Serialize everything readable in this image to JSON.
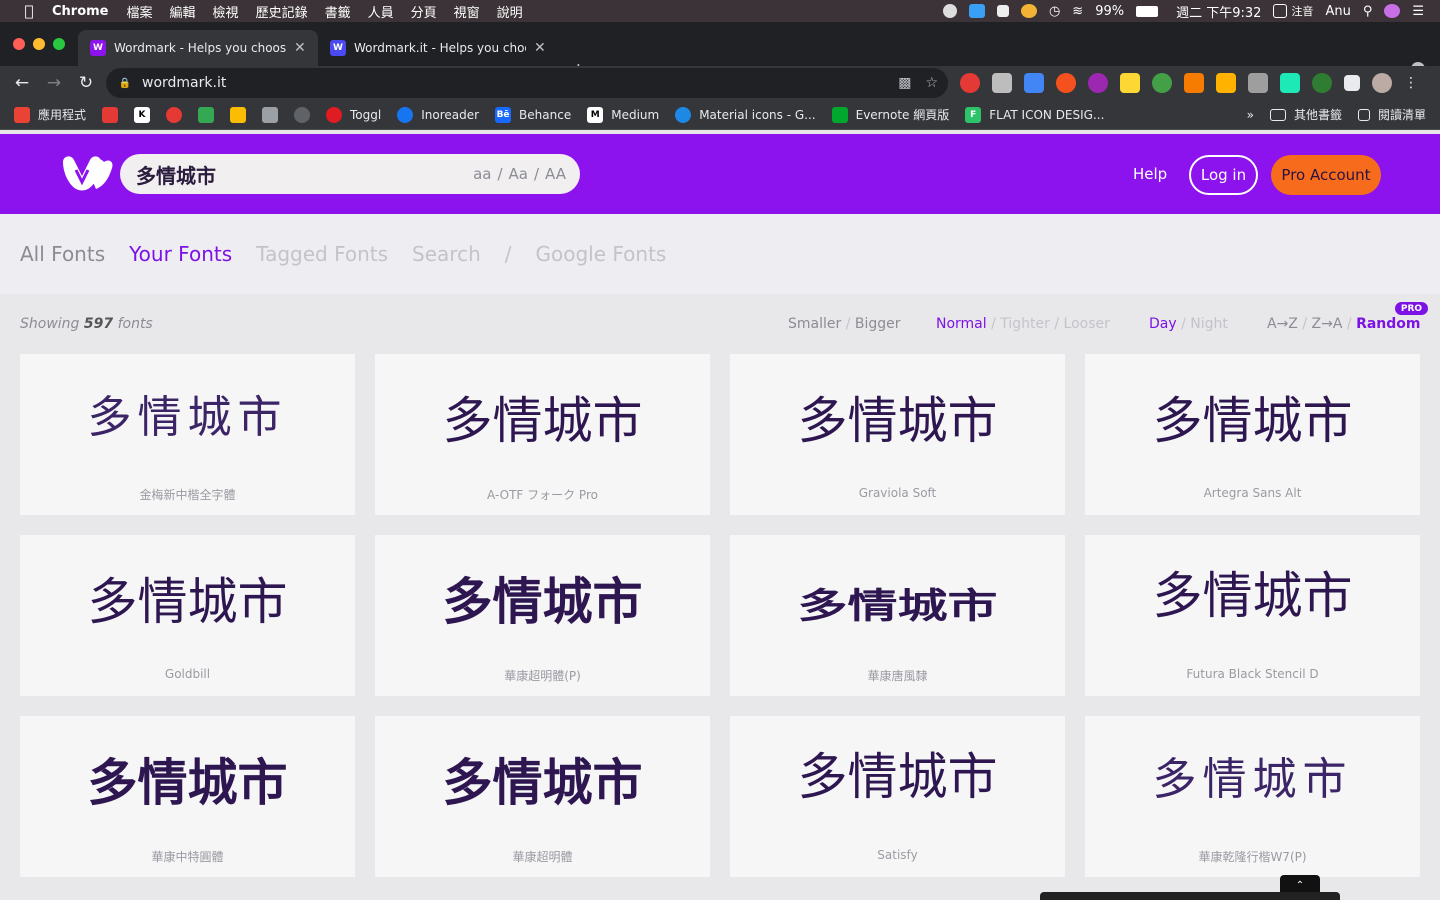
{
  "menubar": {
    "app": "Chrome",
    "items": [
      "檔案",
      "編輯",
      "檢視",
      "歷史記錄",
      "書籤",
      "人員",
      "分頁",
      "視窗",
      "說明"
    ],
    "battery": "99%",
    "clock": "週二 下午9:32",
    "input_method": "注音",
    "user": "Anu"
  },
  "tabs": [
    {
      "title": "Wordmark - Helps you choose",
      "active": true
    },
    {
      "title": "Wordmark.it - Helps you choos",
      "active": false
    }
  ],
  "omnibox": {
    "url": "wordmark.it"
  },
  "bookmarks": [
    {
      "label": "應用程式",
      "icon": "apps-grid-icon",
      "color": "#ea4335"
    },
    {
      "label": "",
      "icon": "red-app-icon",
      "color": "#e53935"
    },
    {
      "label": "",
      "icon": "k-icon",
      "color": "#ffffff"
    },
    {
      "label": "",
      "icon": "red-circle-icon",
      "color": "#e53935"
    },
    {
      "label": "",
      "icon": "drive-icon",
      "color": "#34a853"
    },
    {
      "label": "",
      "icon": "keep-icon",
      "color": "#fbbc04"
    },
    {
      "label": "",
      "icon": "book-icon",
      "color": "#9aa0a6"
    },
    {
      "label": "",
      "icon": "apple-icon",
      "color": "#5f6368"
    },
    {
      "label": "Toggl",
      "icon": "toggl-icon",
      "color": "#e01b22"
    },
    {
      "label": "Inoreader",
      "icon": "inoreader-icon",
      "color": "#1875f0"
    },
    {
      "label": "Behance",
      "icon": "behance-icon",
      "color": "#1769ff"
    },
    {
      "label": "Medium",
      "icon": "medium-icon",
      "color": "#ffffff"
    },
    {
      "label": "Material icons - G...",
      "icon": "material-icon",
      "color": "#1e88e5"
    },
    {
      "label": "Evernote 網頁版",
      "icon": "evernote-icon",
      "color": "#00a82d"
    },
    {
      "label": "FLAT ICON DESIG...",
      "icon": "flaticon-icon",
      "color": "#2cc36b"
    }
  ],
  "bookmarks_right": {
    "more": "»",
    "other": "其他書籤",
    "reading": "閱讀清單"
  },
  "header": {
    "search_value": "多情城市",
    "case_options": [
      "aa",
      "Aa",
      "AA"
    ],
    "help": "Help",
    "login": "Log in",
    "pro": "Pro Account"
  },
  "nav": {
    "tabs": [
      "All Fonts",
      "Your Fonts",
      "Tagged Fonts",
      "Search",
      "/",
      "Google Fonts"
    ],
    "active": "Your Fonts"
  },
  "controls": {
    "showing_prefix": "Showing",
    "count": "597",
    "showing_suffix": "fonts",
    "size": [
      "Smaller",
      "Bigger"
    ],
    "spacing": [
      "Normal",
      "Tighter",
      "Looser"
    ],
    "theme": [
      "Day",
      "Night"
    ],
    "sort": [
      "A→Z",
      "Z→A",
      "Random"
    ],
    "pro_badge": "PRO"
  },
  "sample_text": "多情城市",
  "fonts": [
    {
      "name": "金梅新中楷全字體",
      "style": "thin serif"
    },
    {
      "name": "A-OTF フォーク Pro",
      "style": ""
    },
    {
      "name": "Graviola Soft",
      "style": ""
    },
    {
      "name": "Artegra Sans Alt",
      "style": ""
    },
    {
      "name": "Goldbill",
      "style": "serif"
    },
    {
      "name": "華康超明體(P)",
      "style": "bold serif"
    },
    {
      "name": "華康唐風隸",
      "style": "bold squish"
    },
    {
      "name": "Futura Black Stencil D",
      "style": "up"
    },
    {
      "name": "華康中特圓體",
      "style": "bold"
    },
    {
      "name": "華康超明體",
      "style": "bold serif"
    },
    {
      "name": "Satisfy",
      "style": "up"
    },
    {
      "name": "華康乾隆行楷W7(P)",
      "style": "thin bold"
    }
  ],
  "colors": {
    "brand_purple": "#8c12ee",
    "accent": "#7d12e6",
    "pro_orange": "#f76b1c"
  }
}
